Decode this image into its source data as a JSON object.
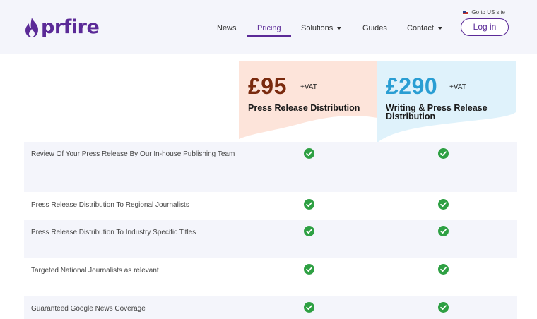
{
  "header": {
    "logo_text": "prfire",
    "us_link": "Go to US site",
    "nav": [
      {
        "label": "News"
      },
      {
        "label": "Pricing",
        "active": true
      },
      {
        "label": "Solutions",
        "has_dropdown": true
      },
      {
        "label": "Guides"
      },
      {
        "label": "Contact",
        "has_dropdown": true
      }
    ],
    "login_label": "Log in"
  },
  "plans": [
    {
      "price": "£95",
      "vat": "+VAT",
      "name": "Press Release Distribution",
      "bg_color": "#fde4da",
      "price_color": "#7a2a0e"
    },
    {
      "price": "£290",
      "vat": "+VAT",
      "name": "Writing & Press Release Distribution",
      "bg_color": "#dff2fb",
      "price_color": "#2a9ed3"
    }
  ],
  "features": [
    {
      "label": "Review Of Your Press Release By Our In-house Publishing Team",
      "plan1": true,
      "plan2": true
    },
    {
      "label": "Press Release Distribution To Regional Journalists",
      "plan1": true,
      "plan2": true
    },
    {
      "label": "Press Release Distribution To Industry Specific Titles",
      "plan1": true,
      "plan2": true
    },
    {
      "label": "Targeted National Journalists as relevant",
      "plan1": true,
      "plan2": true
    },
    {
      "label": "Guaranteed Google News Coverage",
      "plan1": true,
      "plan2": true
    }
  ],
  "colors": {
    "brand": "#5b2a97",
    "check": "#2ea043",
    "alt_row": "#f4f5fb"
  }
}
